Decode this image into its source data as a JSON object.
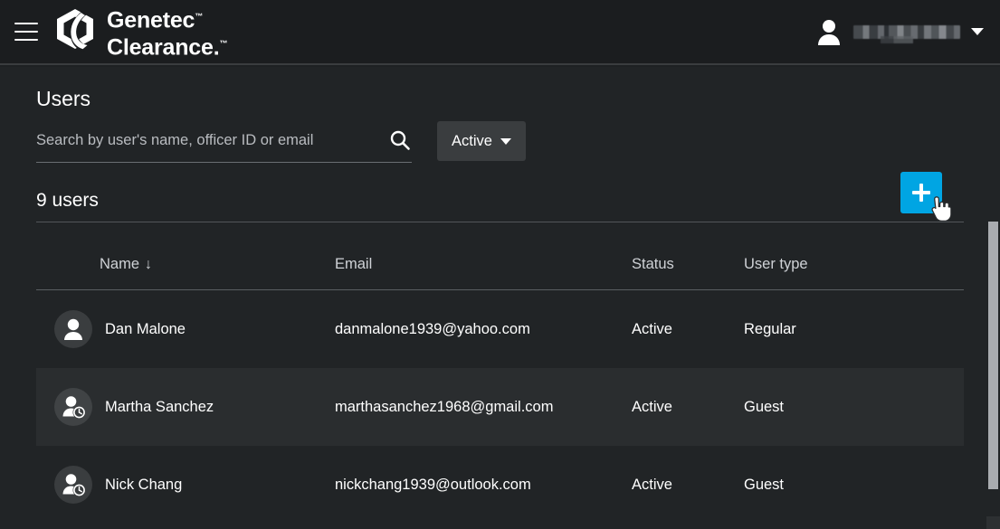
{
  "header": {
    "menu_icon": "hamburger-menu-icon",
    "brand_line1": "Genetec",
    "brand_line2": "Clearance.",
    "trademark": "™",
    "user": {
      "avatar_icon": "user-avatar-icon",
      "name_redacted": "",
      "caret_icon": "chevron-down-icon"
    }
  },
  "page": {
    "title": "Users",
    "count_label": "9 users",
    "add_button_label": "+",
    "accent_color": "#00a5e3",
    "background_color": "#212426",
    "header_color": "#1b1d1f"
  },
  "search": {
    "value": "",
    "placeholder": "Search by user's name, officer ID or email",
    "icon": "search-icon"
  },
  "filter": {
    "label": "Active",
    "caret_icon": "chevron-down-icon"
  },
  "table": {
    "columns": [
      {
        "key": "name",
        "label": "Name",
        "sorted": true,
        "sort_icon": "↓"
      },
      {
        "key": "email",
        "label": "Email",
        "sorted": false,
        "sort_icon": ""
      },
      {
        "key": "status",
        "label": "Status",
        "sorted": false,
        "sort_icon": ""
      },
      {
        "key": "type",
        "label": "User type",
        "sorted": false,
        "sort_icon": ""
      }
    ],
    "rows": [
      {
        "name": "Dan Malone",
        "email": "danmalone1939@yahoo.com",
        "status": "Active",
        "type": "Regular",
        "avatar_icon": "user-avatar-icon"
      },
      {
        "name": "Martha Sanchez",
        "email": "marthasanchez1968@gmail.com",
        "status": "Active",
        "type": "Guest",
        "avatar_icon": "guest-user-avatar-icon"
      },
      {
        "name": "Nick Chang",
        "email": "nickchang1939@outlook.com",
        "status": "Active",
        "type": "Guest",
        "avatar_icon": "guest-user-avatar-icon"
      }
    ]
  },
  "cursor": {
    "type": "pointer-hand"
  }
}
